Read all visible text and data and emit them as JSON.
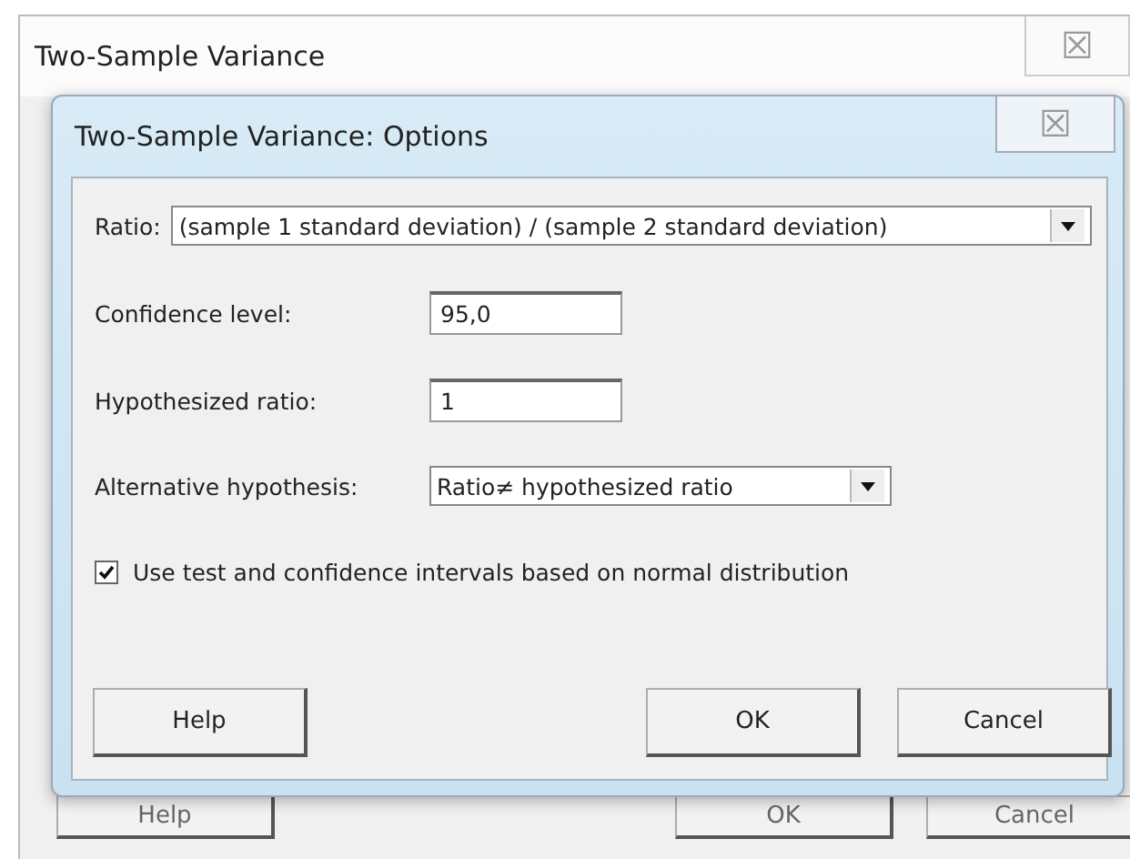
{
  "window": {
    "title": "Two-Sample Variance",
    "close": "☒",
    "buttons": [
      {
        "label": "Help",
        "kind": "help"
      },
      {
        "label": "OK",
        "kind": "ok"
      },
      {
        "label": "Cancel",
        "kind": "cancel"
      }
    ]
  },
  "dialog": {
    "title": "Two-Sample Variance: Options",
    "close": "☒",
    "ratio": {
      "label": "Ratio:",
      "value": "(sample 1 standard deviation) / (sample 2 standard deviation)"
    },
    "confidence": {
      "label": "Confidence level:",
      "value": "95,0"
    },
    "hypothesized": {
      "label": "Hypothesized ratio:",
      "value": "1"
    },
    "alternative": {
      "label": "Alternative hypothesis:",
      "value": "Ratio≠ hypothesized ratio"
    },
    "normal": {
      "label": "Use test and confidence intervals based on normal distribution",
      "checked": true
    },
    "buttons": [
      {
        "label": "Help",
        "kind": "help"
      },
      {
        "label": "OK",
        "kind": "ok"
      },
      {
        "label": "Cancel",
        "kind": "cancel"
      }
    ]
  }
}
